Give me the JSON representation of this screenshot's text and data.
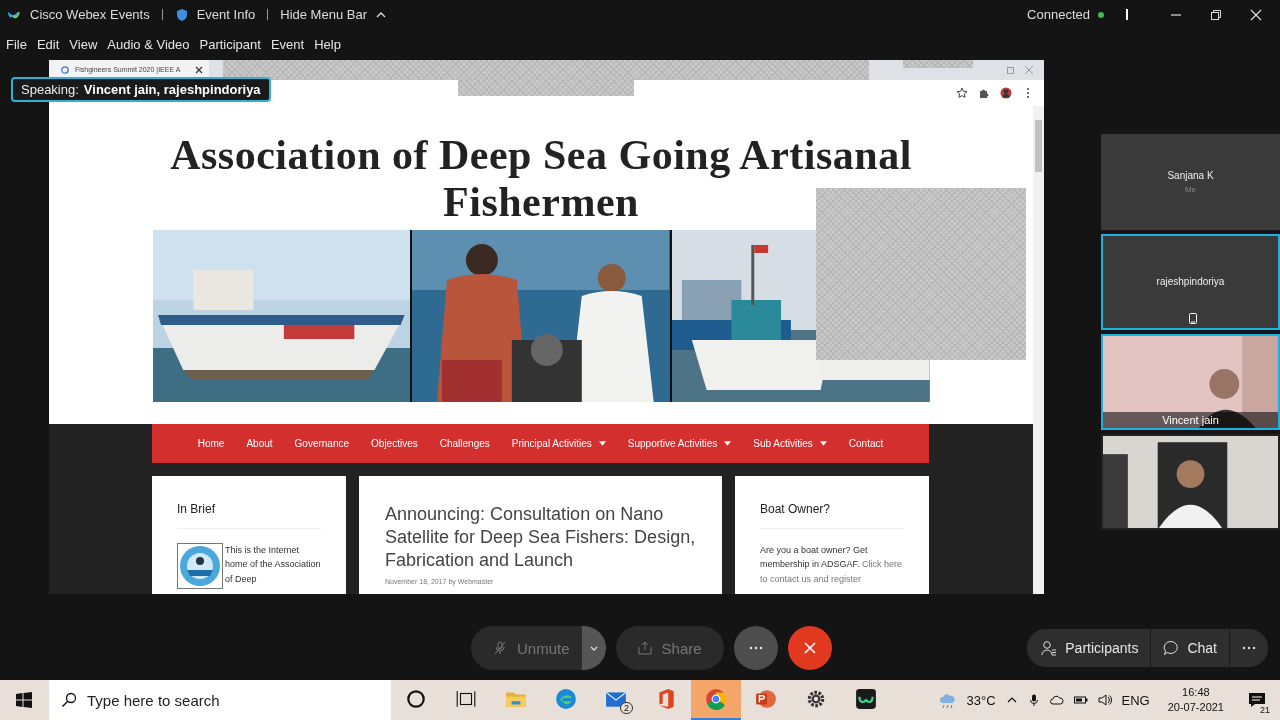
{
  "app_bar": {
    "app_name": "Cisco Webex Events",
    "event_info": "Event Info",
    "hide_menu": "Hide Menu Bar",
    "status": "Connected",
    "connected": true
  },
  "menu": [
    "File",
    "Edit",
    "View",
    "Audio & Video",
    "Participant",
    "Event",
    "Help"
  ],
  "speaking": {
    "label": "Speaking:",
    "names": "Vincent jain, rajeshpindoriya"
  },
  "browser": {
    "tab_title": "Fishgineers Summit 2020 |IEEE A"
  },
  "site": {
    "title": "Association of Deep Sea Going Artisanal Fishermen",
    "nav": [
      {
        "label": "Home",
        "dropdown": false
      },
      {
        "label": "About",
        "dropdown": false
      },
      {
        "label": "Governance",
        "dropdown": false
      },
      {
        "label": "Objectives",
        "dropdown": false
      },
      {
        "label": "Challenges",
        "dropdown": false
      },
      {
        "label": "Principal Activities",
        "dropdown": true
      },
      {
        "label": "Supportive Activities",
        "dropdown": true
      },
      {
        "label": "Sub Activities",
        "dropdown": true
      },
      {
        "label": "Contact",
        "dropdown": false
      }
    ],
    "brief": {
      "heading": "In Brief",
      "text": "This is the Internet home of the Association of Deep"
    },
    "post": {
      "headline": "Announcing: Consultation on Nano Satellite for Deep Sea Fishers: Design, Fabrication and Launch",
      "meta": "November 18, 2017 by Webmaster"
    },
    "boat": {
      "heading": "Boat Owner?",
      "text": "Are you a boat owner? Get membership in ADSGAF.",
      "link": "Click here to contact us and register"
    }
  },
  "participants": [
    {
      "kind": "avatar",
      "name": "Sanjana K",
      "note": "Me",
      "speaking": false
    },
    {
      "kind": "avatar",
      "name": "rajeshpindoriya",
      "phone": true,
      "speaking": true
    },
    {
      "kind": "video",
      "name": "Vincent jain",
      "speaking": true
    },
    {
      "kind": "video",
      "speaking": false
    }
  ],
  "controls": [
    {
      "kind": "unmute",
      "label": "Unmute",
      "disabled": true
    },
    {
      "kind": "share",
      "label": "Share",
      "disabled": true
    },
    {
      "kind": "more"
    },
    {
      "kind": "end"
    }
  ],
  "side_controls": [
    {
      "kind": "participants",
      "label": "Participants"
    },
    {
      "kind": "chat",
      "label": "Chat"
    },
    {
      "kind": "more"
    }
  ],
  "taskbar": {
    "search_placeholder": "Type here to search",
    "apps": [
      {
        "kind": "cortana",
        "active": false
      },
      {
        "kind": "taskview",
        "active": false
      },
      {
        "kind": "folder",
        "active": false
      },
      {
        "kind": "edge",
        "active": false
      },
      {
        "kind": "mail",
        "badge": "2",
        "active": false
      },
      {
        "kind": "office",
        "active": false
      },
      {
        "kind": "chrome",
        "active": true
      },
      {
        "kind": "powerpoint",
        "active": false
      },
      {
        "kind": "settings",
        "active": false
      },
      {
        "kind": "webex",
        "active": false
      }
    ],
    "temperature": "33°C",
    "language": "ENG",
    "time": "16:48",
    "date": "20-07-2021",
    "notifications": "21"
  }
}
